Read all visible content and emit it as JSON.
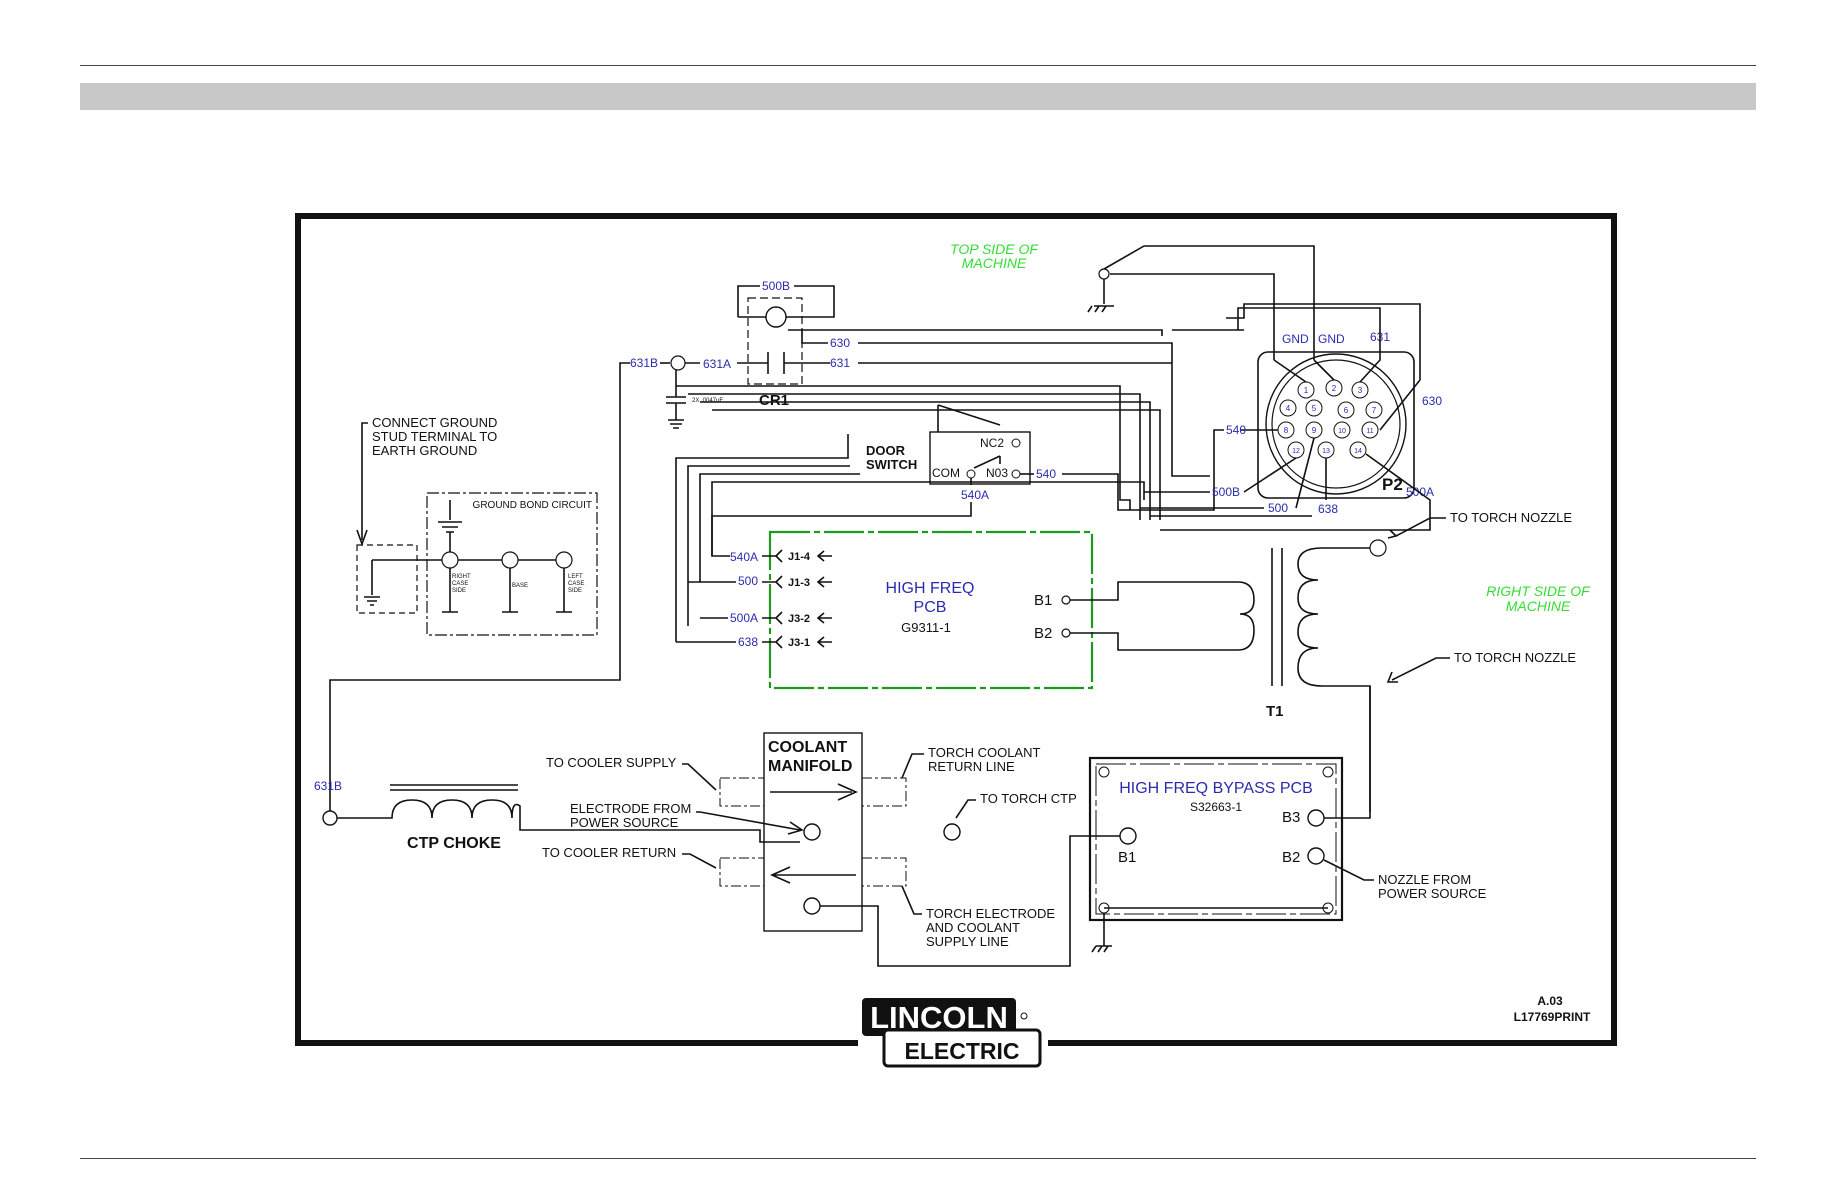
{
  "diagram": {
    "top_side_label": [
      "TOP SIDE OF",
      "MACHINE"
    ],
    "right_side_label": [
      "RIGHT SIDE OF",
      "MACHINE"
    ],
    "ground_note": [
      "CONNECT GROUND",
      "STUD TERMINAL TO",
      "EARTH GROUND"
    ],
    "ground_bond": {
      "title": "GROUND BOND CIRCUIT",
      "points": [
        [
          "RIGHT",
          "CASE",
          "SIDE"
        ],
        [
          "BASE"
        ],
        [
          "LEFT",
          "CASE",
          "SIDE"
        ]
      ]
    },
    "cr1": {
      "label": "CR1",
      "cap_value": "2X .0047uF"
    },
    "wires": {
      "w631B": "631B",
      "w631A": "631A",
      "w631": "631",
      "w630": "630",
      "w500B": "500B",
      "w540": "540",
      "w540A": "540A",
      "w500": "500",
      "w500A": "500A",
      "w638": "638"
    },
    "door_switch": {
      "label": [
        "DOOR",
        "SWITCH"
      ],
      "nc": "NC2",
      "com": "COM",
      "no": "N03"
    },
    "hf_pcb": {
      "title": [
        "HIGH FREQ",
        "PCB"
      ],
      "part": "G9311-1",
      "pins": [
        "J1-4",
        "J1-3",
        "J3-2",
        "J3-1"
      ],
      "b1": "B1",
      "b2": "B2"
    },
    "p2": {
      "label": "P2",
      "gnd": "GND",
      "pins": [
        "1",
        "2",
        "3",
        "4",
        "5",
        "6",
        "7",
        "8",
        "9",
        "10",
        "11",
        "12",
        "13",
        "14"
      ]
    },
    "t1": "T1",
    "to_torch_nozzle": "TO TORCH NOZZLE",
    "ctp_choke": "CTP CHOKE",
    "manifold": {
      "title": [
        "COOLANT",
        "MANIFOLD"
      ],
      "to_cooler_supply": "TO COOLER SUPPLY",
      "electrode_from": [
        "ELECTRODE FROM",
        "POWER SOURCE"
      ],
      "to_cooler_return": "TO COOLER RETURN",
      "torch_coolant_return": [
        "TORCH COOLANT",
        "RETURN LINE"
      ],
      "to_torch_ctp": "TO TORCH CTP",
      "torch_electrode": [
        "TORCH ELECTRODE",
        "AND COOLANT",
        "SUPPLY LINE"
      ]
    },
    "bypass_pcb": {
      "title": "HIGH FREQ BYPASS PCB",
      "part": "S32663-1",
      "b1": "B1",
      "b2": "B2",
      "b3": "B3"
    },
    "nozzle_from": [
      "NOZZLE FROM",
      "POWER SOURCE"
    ],
    "revision": "A.03",
    "print_id": "L17769PRINT",
    "logo": {
      "line1": "LINCOLN",
      "line2": "ELECTRIC"
    }
  }
}
